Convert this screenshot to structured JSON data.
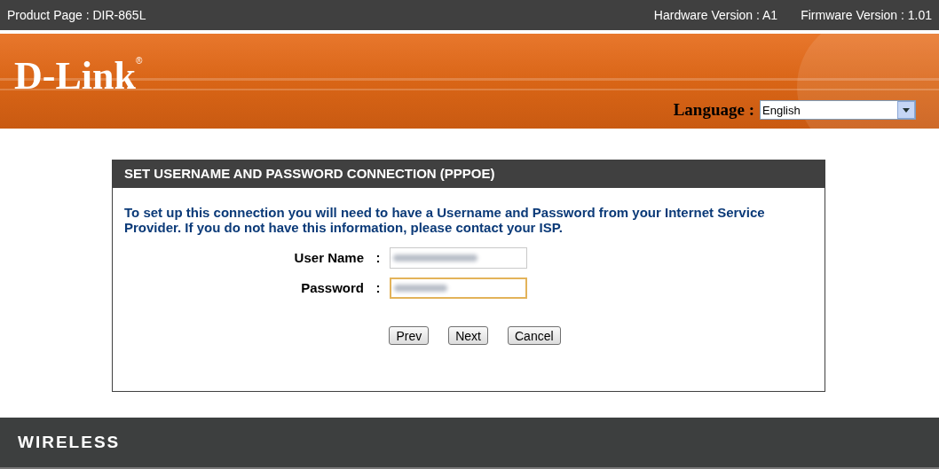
{
  "top_bar": {
    "product": "Product Page : DIR-865L",
    "hardware": "Hardware Version : A1",
    "firmware": "Firmware Version : 1.01"
  },
  "header": {
    "logo": "D-Link",
    "logo_mark": "®",
    "language_label": "Language :",
    "language_value": "English"
  },
  "panel": {
    "title": "SET USERNAME AND PASSWORD CONNECTION (PPPOE)",
    "intro": "To set up this connection you will need to have a Username and Password from your Internet Service Provider. If you do not have this information, please contact your ISP.",
    "fields": [
      {
        "label": "User Name",
        "separator": ":",
        "focused": false
      },
      {
        "label": "Password",
        "separator": ":",
        "focused": true
      }
    ],
    "buttons": [
      "Prev",
      "Next",
      "Cancel"
    ]
  },
  "footer": {
    "brand": "WIRELESS"
  }
}
